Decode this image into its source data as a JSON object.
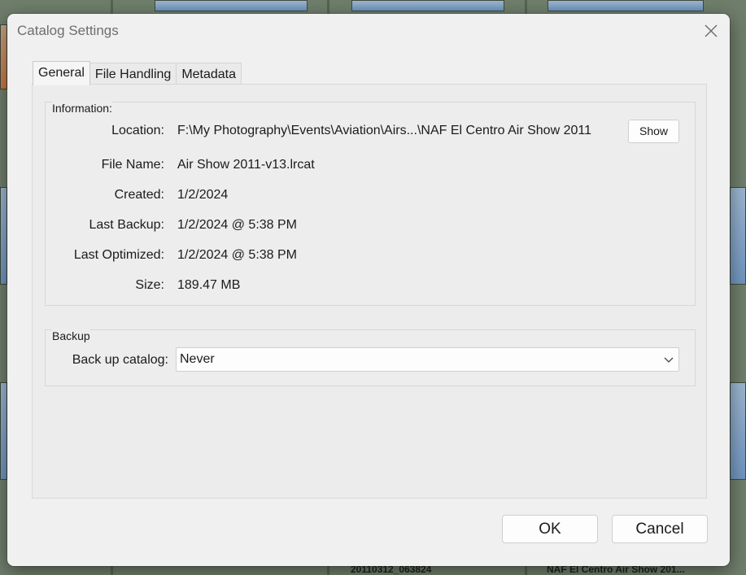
{
  "dialog": {
    "title": "Catalog Settings",
    "close_icon": "close-icon"
  },
  "tabs": [
    {
      "label": "General",
      "active": true
    },
    {
      "label": "File Handling",
      "active": false
    },
    {
      "label": "Metadata",
      "active": false
    }
  ],
  "information": {
    "group_label": "Information:",
    "location_label": "Location:",
    "location_value": "F:\\My Photography\\Events\\Aviation\\Airs...\\NAF El Centro Air Show 2011",
    "show_button": "Show",
    "file_name_label": "File Name:",
    "file_name_value": "Air Show 2011-v13.lrcat",
    "created_label": "Created:",
    "created_value": "1/2/2024",
    "last_backup_label": "Last Backup:",
    "last_backup_value": "1/2/2024 @ 5:38 PM",
    "last_optimized_label": "Last Optimized:",
    "last_optimized_value": "1/2/2024 @ 5:38 PM",
    "size_label": "Size:",
    "size_value": "189.47 MB"
  },
  "backup": {
    "group_label": "Backup",
    "catalog_label": "Back up catalog:",
    "catalog_value": "Never",
    "dropdown_icon": "chevron-down-icon"
  },
  "footer": {
    "ok_label": "OK",
    "cancel_label": "Cancel"
  },
  "background": {
    "caption_left": "20110312_063824",
    "caption_right": "NAF El Centro Air Show 201..."
  },
  "colors": {
    "dialog_bg": "#f0f0f0",
    "grid_bg": "#6f7d6b"
  }
}
